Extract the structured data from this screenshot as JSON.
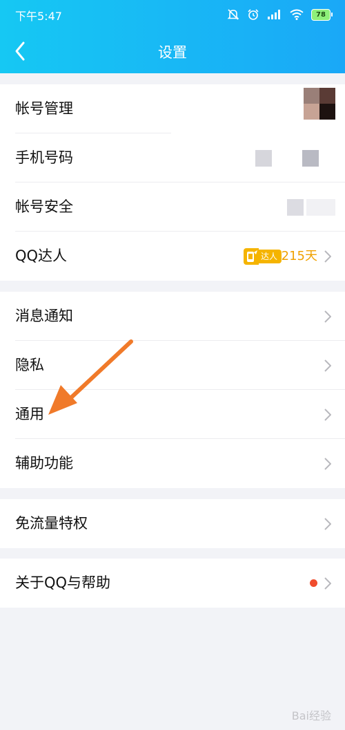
{
  "status_bar": {
    "time": "下午5:47",
    "battery": "78",
    "icons": [
      "mute-bell-icon",
      "alarm-icon",
      "signal-icon",
      "wifi-icon",
      "battery-icon"
    ]
  },
  "header": {
    "title": "设置",
    "back_icon": "chevron-left-icon"
  },
  "groups": [
    {
      "items": [
        {
          "label": "帐号管理"
        },
        {
          "label": "手机号码"
        },
        {
          "label": "帐号安全"
        },
        {
          "label": "QQ达人",
          "badge_text": "达人",
          "days": "215天"
        }
      ]
    },
    {
      "items": [
        {
          "label": "消息通知"
        },
        {
          "label": "隐私"
        },
        {
          "label": "通用"
        },
        {
          "label": "辅助功能"
        }
      ]
    },
    {
      "items": [
        {
          "label": "免流量特权"
        }
      ]
    },
    {
      "items": [
        {
          "label": "关于QQ与帮助",
          "has_red_dot": true
        }
      ]
    }
  ],
  "watermark": "Bai经验",
  "colors": {
    "header_start": "#16c8f3",
    "header_end": "#1aa8f7",
    "page_background": "#f2f3f7",
    "annotation_arrow": "#f07a2a",
    "daren_gold": "#f5b400",
    "red_dot": "#f04c2d"
  }
}
